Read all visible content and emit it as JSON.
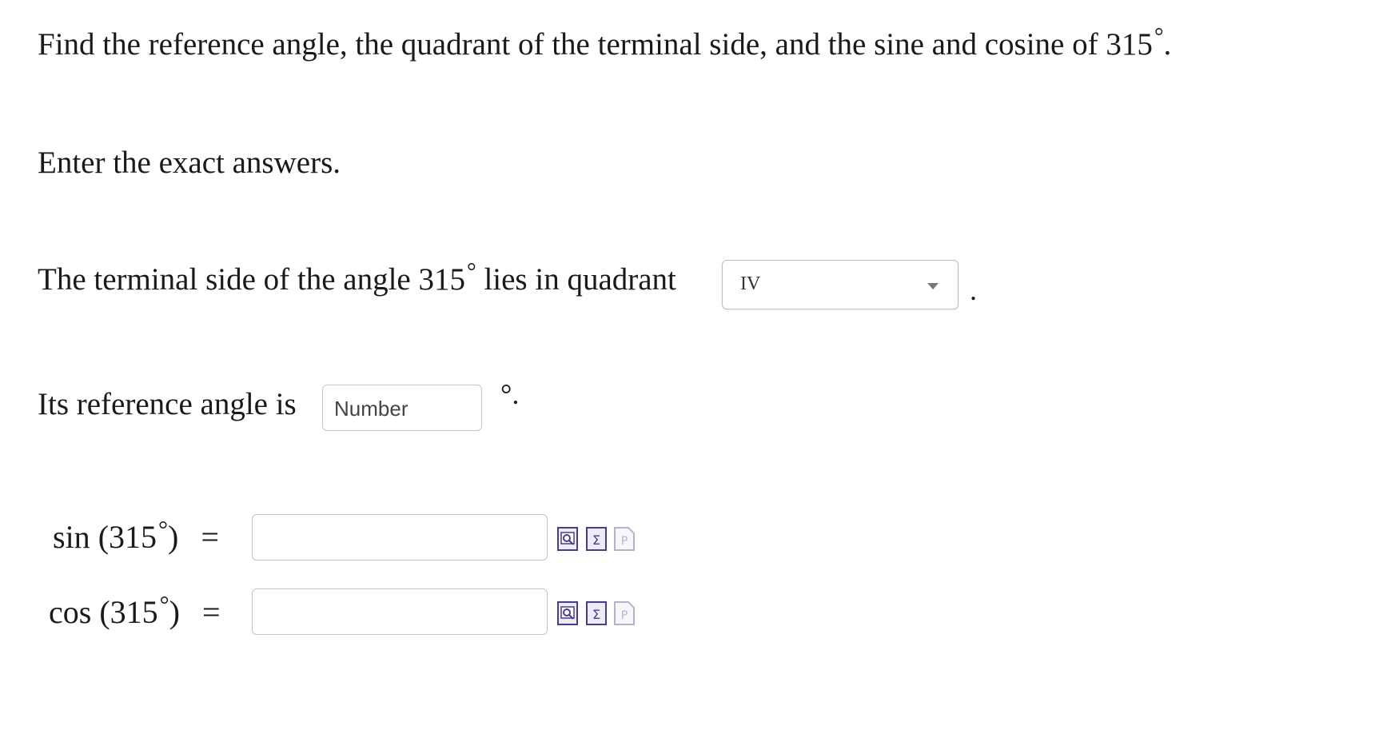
{
  "question": {
    "line1_text": "Find the reference angle, the quadrant of the terminal side, and the sine and cosine of 315",
    "line1_deg": "°",
    "line1_end": ".",
    "line2": "Enter the exact answers."
  },
  "quadrant": {
    "prefix": "The terminal side of the angle 315",
    "deg": "°",
    "suffix": " lies in quadrant",
    "selected": "IV",
    "trailing": "."
  },
  "reference": {
    "label": "Its reference angle is",
    "placeholder": "Number",
    "unit": "°."
  },
  "sin_row": {
    "func": "sin",
    "arg": "(315",
    "deg": "°",
    "close": ")",
    "eq": "="
  },
  "cos_row": {
    "func": "cos",
    "arg": "(315",
    "deg": "°",
    "close": ")",
    "eq": "="
  },
  "tools": {
    "preview_icon": "preview-icon",
    "equation_editor_icon": "equation-editor-icon",
    "answer_icon": "answer-format-icon",
    "accent_color": "#4a3b8f"
  }
}
